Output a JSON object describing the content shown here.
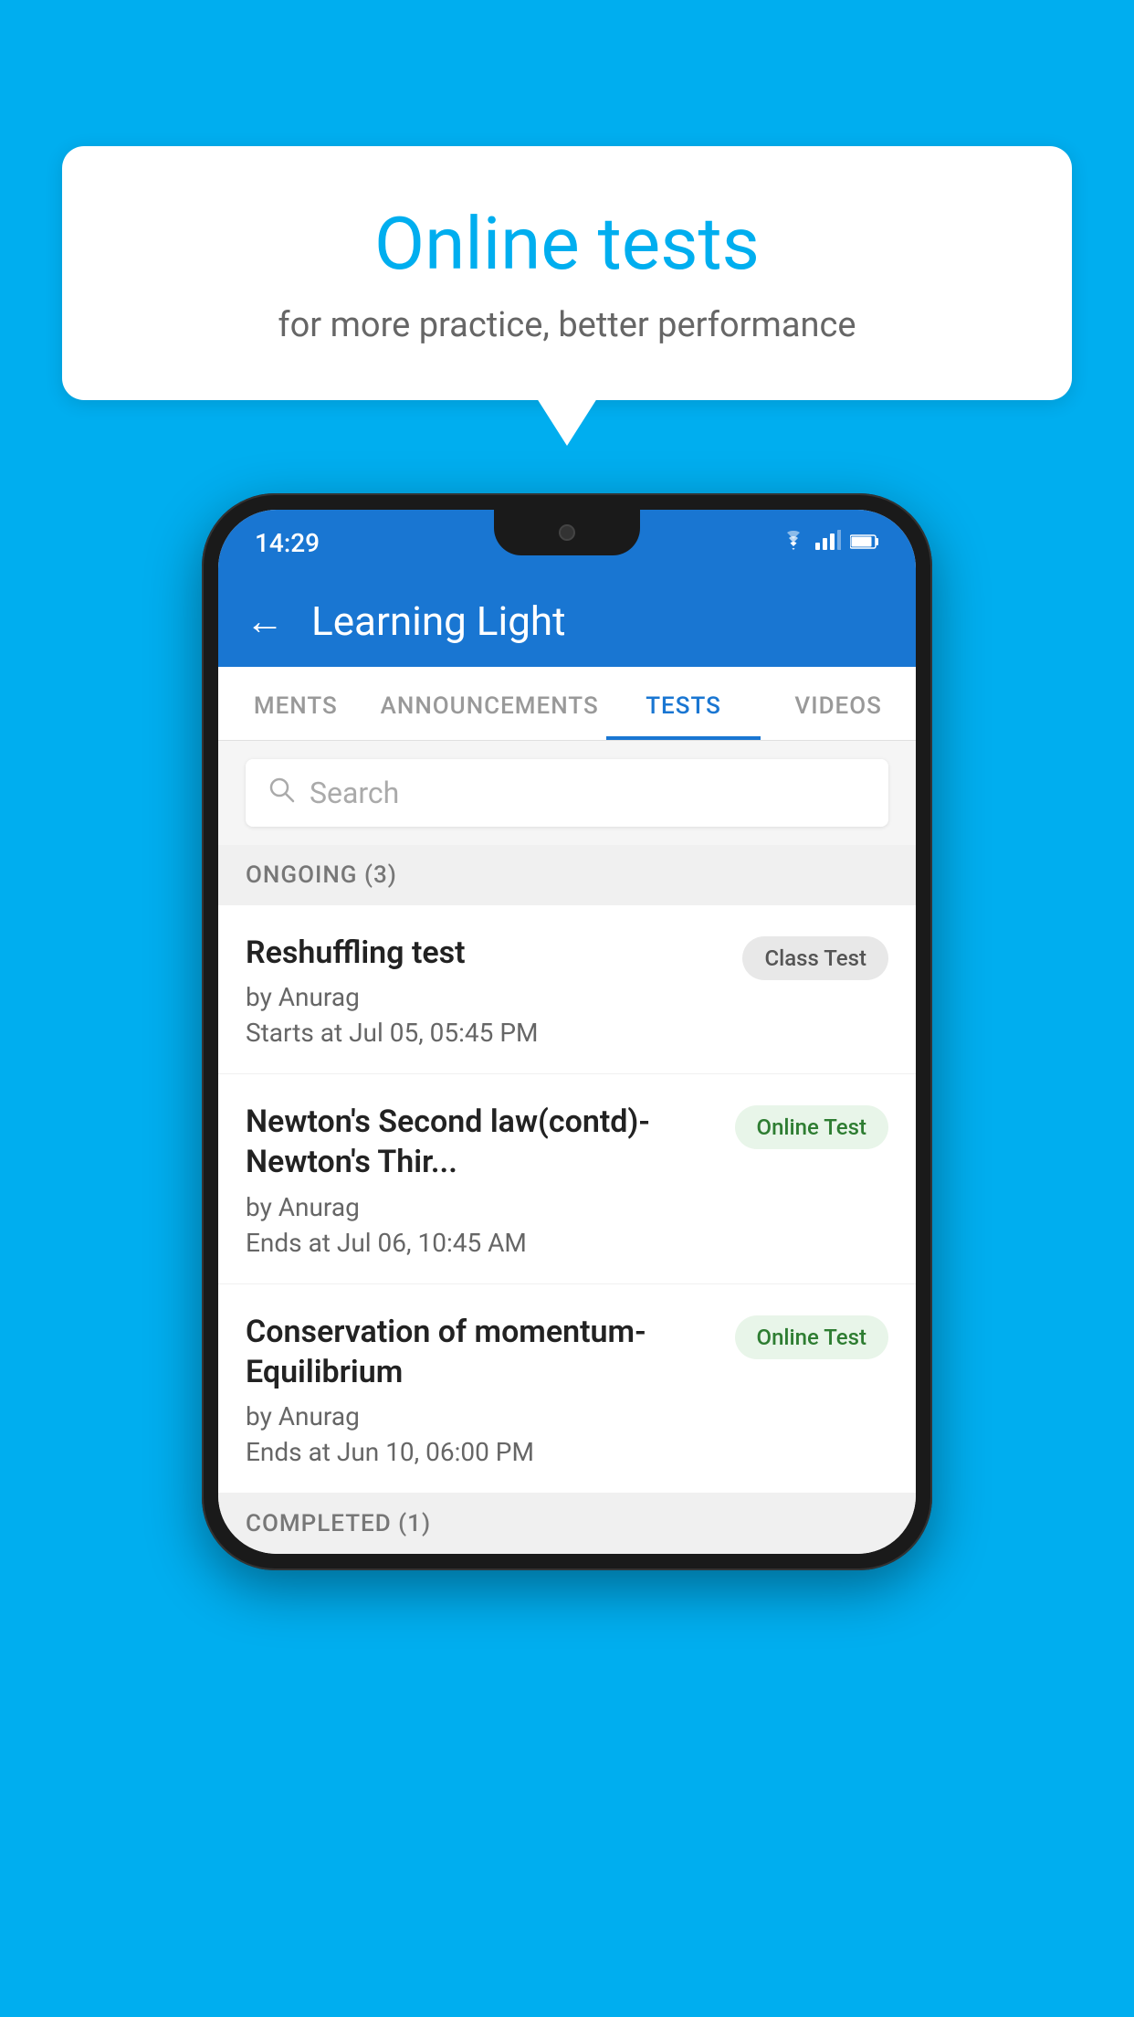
{
  "background": {
    "color": "#00AEEF"
  },
  "bubble": {
    "title": "Online tests",
    "subtitle": "for more practice, better performance"
  },
  "phone": {
    "status_bar": {
      "time": "14:29",
      "wifi": "▾",
      "signal": "▴",
      "battery": "▮"
    },
    "app_bar": {
      "back_label": "←",
      "title": "Learning Light"
    },
    "tabs": [
      {
        "label": "MENTS",
        "active": false
      },
      {
        "label": "ANNOUNCEMENTS",
        "active": false
      },
      {
        "label": "TESTS",
        "active": true
      },
      {
        "label": "VIDEOS",
        "active": false
      }
    ],
    "search": {
      "placeholder": "Search"
    },
    "ongoing_section": {
      "label": "ONGOING (3)"
    },
    "tests": [
      {
        "title": "Reshuffling test",
        "author": "by Anurag",
        "date": "Starts at  Jul 05, 05:45 PM",
        "badge": "Class Test",
        "badge_type": "class"
      },
      {
        "title": "Newton's Second law(contd)-Newton's Thir...",
        "author": "by Anurag",
        "date": "Ends at  Jul 06, 10:45 AM",
        "badge": "Online Test",
        "badge_type": "online"
      },
      {
        "title": "Conservation of momentum-Equilibrium",
        "author": "by Anurag",
        "date": "Ends at  Jun 10, 06:00 PM",
        "badge": "Online Test",
        "badge_type": "online"
      }
    ],
    "completed_section": {
      "label": "COMPLETED (1)"
    }
  }
}
